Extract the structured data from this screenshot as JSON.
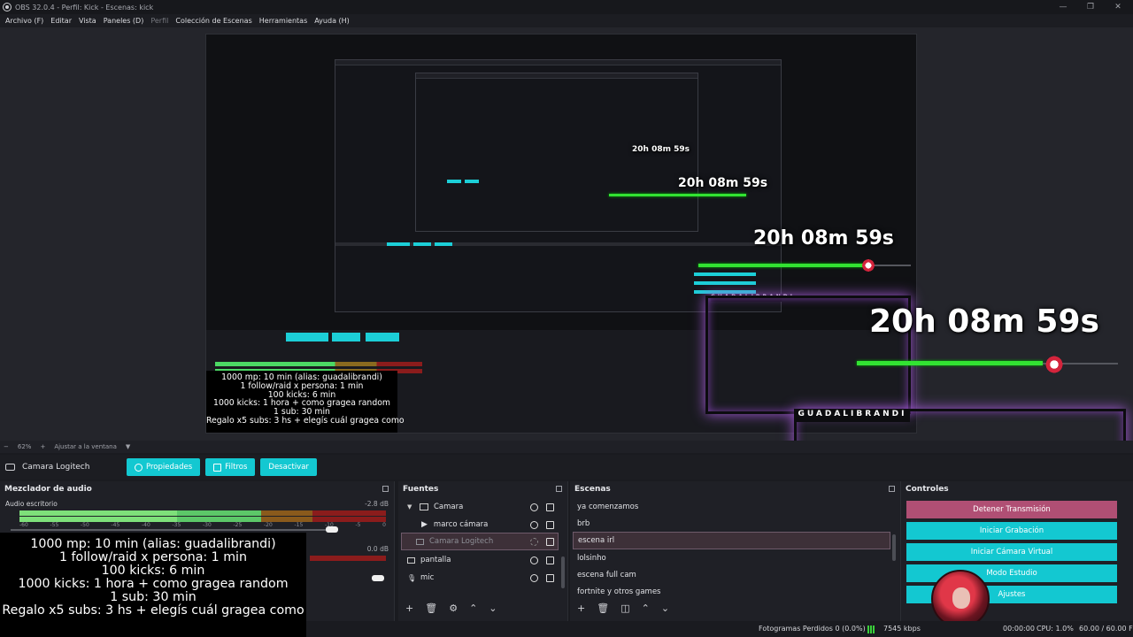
{
  "window": {
    "title": "OBS 32.0.4 - Perfil: Kick - Escenas: kick",
    "controls": [
      "—",
      "❐",
      "✕"
    ]
  },
  "menu": {
    "items": [
      {
        "label": "Archivo (F)",
        "enabled": true
      },
      {
        "label": "Editar",
        "enabled": true
      },
      {
        "label": "Vista",
        "enabled": true
      },
      {
        "label": "Paneles (D)",
        "enabled": true
      },
      {
        "label": "Perfil",
        "enabled": false
      },
      {
        "label": "Colección de Escenas",
        "enabled": true
      },
      {
        "label": "Herramientas",
        "enabled": true
      },
      {
        "label": "Ayuda (H)",
        "enabled": true
      }
    ]
  },
  "overlay": {
    "timer": "20h 08m 59s",
    "brand": "GUADALIBRANDI",
    "rules": [
      "1000 mp: 10 min (alias: guadalibrandi)",
      "1 follow/raid x persona: 1 min",
      "100 kicks: 6 min",
      "1000 kicks: 1 hora + como gragea random",
      "1 sub: 30 min",
      "Regalo x5 subs: 3 hs + elegís cuál gragea como"
    ]
  },
  "zoom": {
    "minus": "−",
    "value": "62%",
    "plus": "+",
    "fit": "Ajustar a la ventana",
    "caret": "▼"
  },
  "source_bar": {
    "selected_source": "Camara Logitech",
    "properties": "Propiedades",
    "filters": "Filtros",
    "deactivate": "Desactivar"
  },
  "mixer": {
    "title": "Mezclador de audio",
    "track": "Audio escritorio",
    "db_top": "-2.8 dB",
    "db_bottom": "0.0 dB",
    "ticks": [
      "-60",
      "-55",
      "-50",
      "-45",
      "-40",
      "-35",
      "-30",
      "-25",
      "-20",
      "-15",
      "-10",
      "-5",
      "0"
    ]
  },
  "sources": {
    "title": "Fuentes",
    "items": [
      {
        "label": "Camara",
        "type": "folder"
      },
      {
        "label": "marco cámara",
        "type": "play"
      },
      {
        "label": "Camara Logitech",
        "type": "camera",
        "hidden": true
      },
      {
        "label": "pantalla",
        "type": "monitor"
      },
      {
        "label": "mic",
        "type": "mic"
      }
    ],
    "footer": [
      "+",
      "🗑",
      "⚙",
      "⌃",
      "⌄"
    ]
  },
  "scenes": {
    "title": "Escenas",
    "items": [
      "ya comenzamos",
      "brb",
      "escena irl",
      "lolsinho",
      "escena full cam",
      "fortnite y otros games"
    ],
    "selected": "escena irl",
    "footer": [
      "+",
      "🗑",
      "◫",
      "⌃",
      "⌄"
    ]
  },
  "controls": {
    "title": "Controles",
    "buttons": [
      {
        "label": "Detener Transmisión",
        "color": "#b04f74"
      },
      {
        "label": "Iniciar Grabación",
        "color": "#13c8d1"
      },
      {
        "label": "Iniciar Cámara Virtual",
        "color": "#13c8d1"
      },
      {
        "label": "Modo Estudio",
        "color": "#13c8d1"
      },
      {
        "label": "Ajustes",
        "color": "#13c8d1"
      }
    ]
  },
  "status": {
    "dropped": "Fotogramas Perdidos 0 (0.0%)",
    "bitrate": "7545 kbps",
    "rec_time": "00:00:00",
    "cpu": "CPU: 1.0%",
    "fps": "60.00 / 60.00 FPS"
  },
  "colors": {
    "accent": "#13c8d1",
    "stop_stream": "#b04f74",
    "meter_green": "#4cd964",
    "meter_red": "#8b1c1c",
    "timer_bar": "#32e332"
  }
}
